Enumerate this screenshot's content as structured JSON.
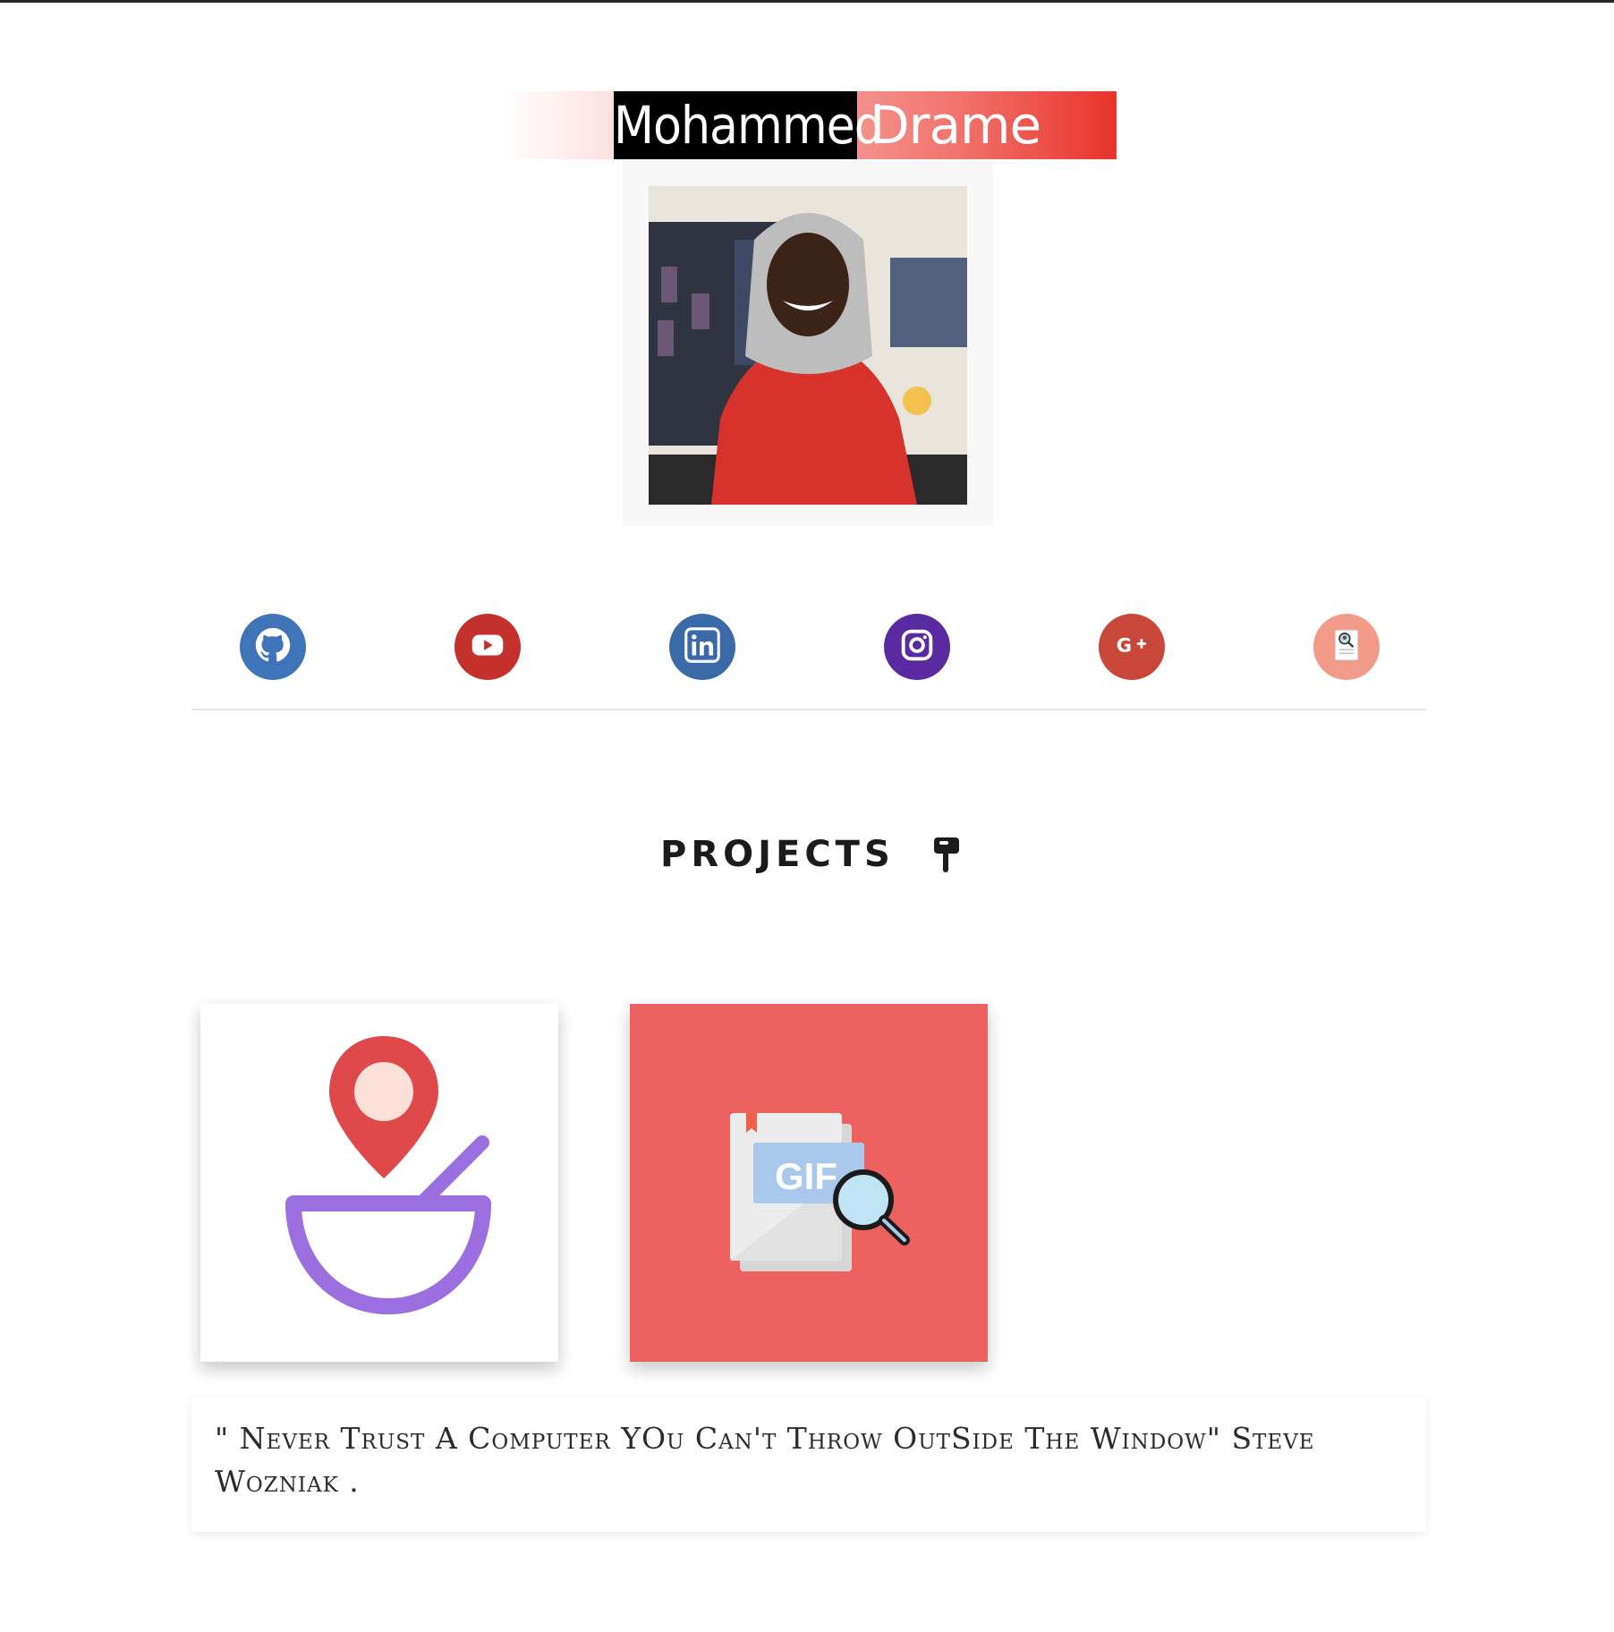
{
  "header": {
    "first_name": "Mohammed",
    "last_name": "Drame"
  },
  "profile_photo": {
    "alt": "Profile photo"
  },
  "social_links": [
    {
      "name": "github",
      "icon": "github-icon",
      "color": "#3f74b8"
    },
    {
      "name": "youtube",
      "icon": "youtube-icon",
      "color": "#c4302b"
    },
    {
      "name": "linkedin",
      "icon": "linkedin-icon",
      "color": "#3b6aa8"
    },
    {
      "name": "instagram",
      "icon": "instagram-icon",
      "color": "#5a2aa0"
    },
    {
      "name": "google-plus",
      "icon": "google-plus-icon",
      "color": "#c9463a"
    },
    {
      "name": "resume",
      "icon": "resume-search-icon",
      "color": "#f29b88"
    }
  ],
  "projects": {
    "title": "PROJECTS",
    "items": [
      {
        "icon": "map-pin-bowl-icon",
        "bg": "#ffffff"
      },
      {
        "icon": "gif-search-icon",
        "bg": "#ed625e",
        "badge": "GIF"
      }
    ]
  },
  "quote": {
    "text": "\" Never Trust A Computer YOu Can't Throw OutSide The Window\" Steve Wozniak ."
  }
}
